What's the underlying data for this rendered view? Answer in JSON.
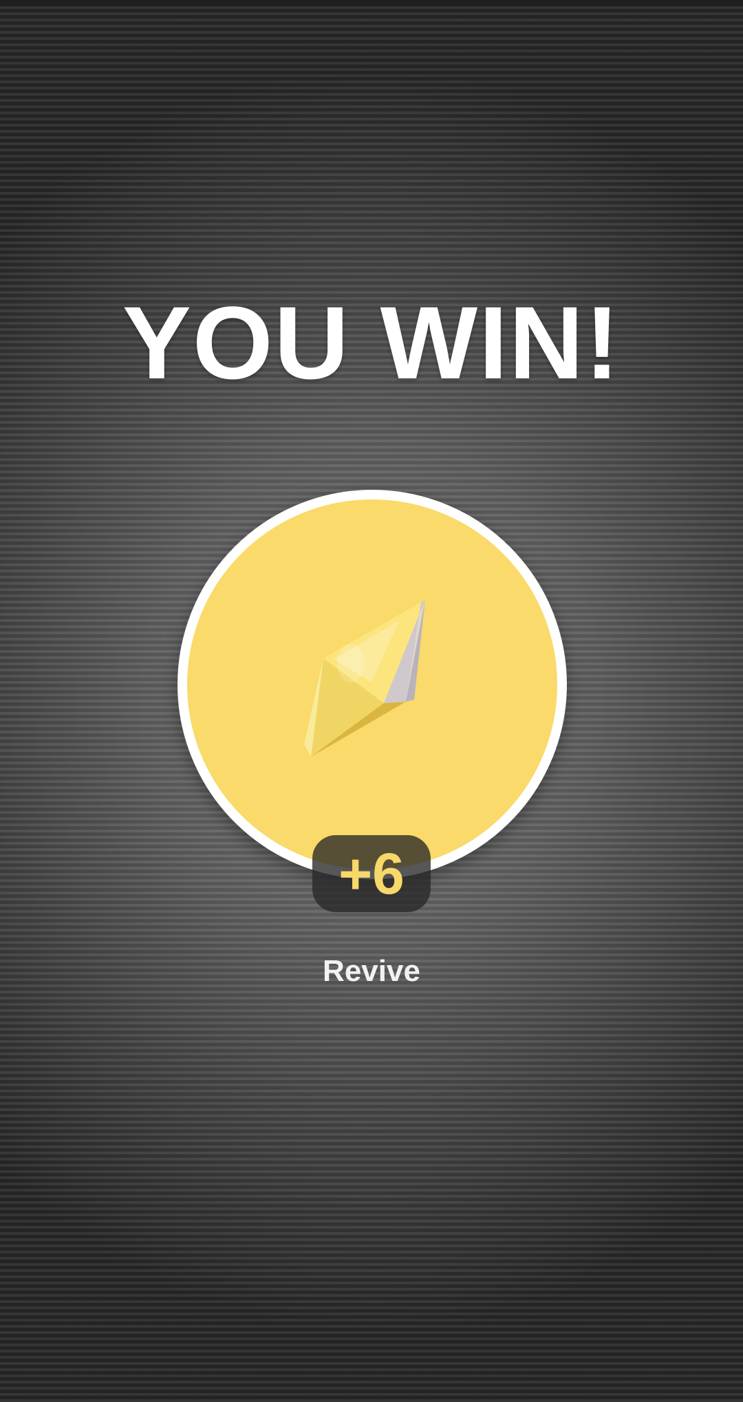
{
  "screen": {
    "title": "YOU WIN!"
  },
  "reward": {
    "icon": "yellow-crystal-icon",
    "amount": "+6",
    "circle_color": "#f9da6a",
    "amount_color": "#f7d869"
  },
  "actions": {
    "revive_label": "Revive"
  }
}
